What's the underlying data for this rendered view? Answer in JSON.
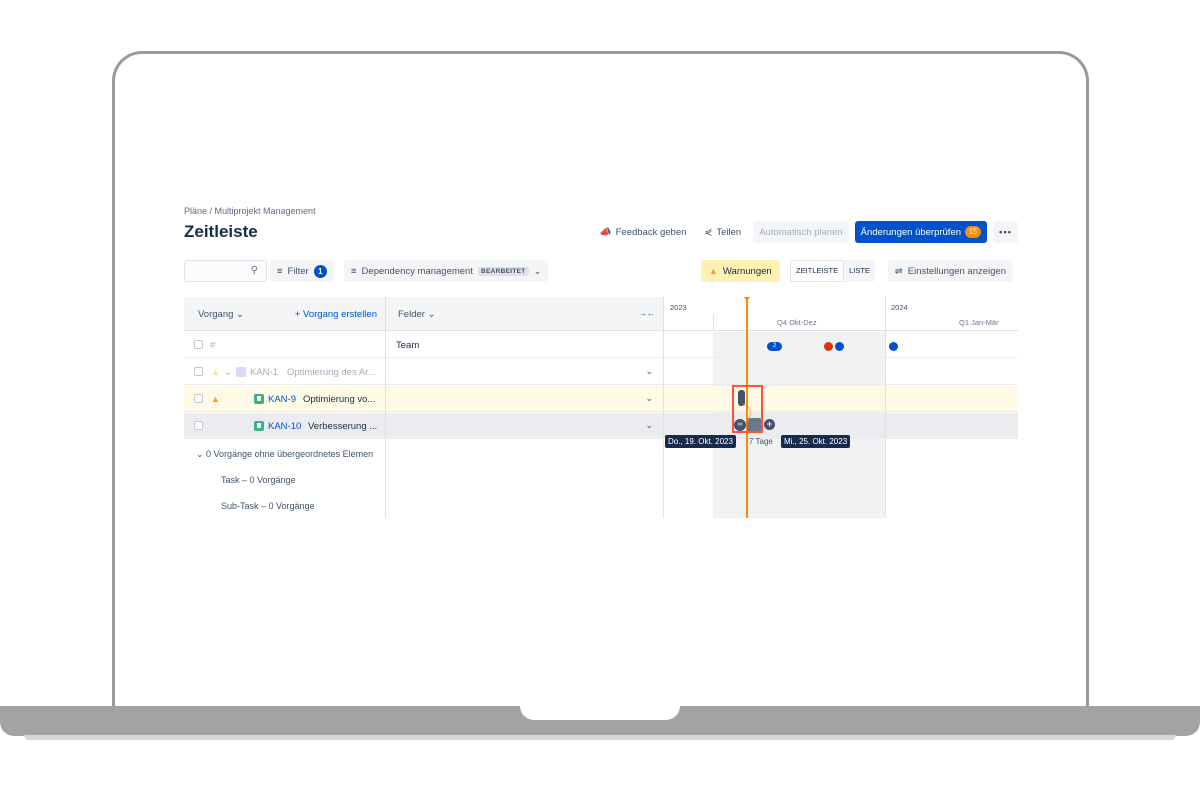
{
  "breadcrumb": "Pläne  /  Multiprojekt Management",
  "title": "Zeitleiste",
  "actions": {
    "feedback": "Feedback geben",
    "share": "Teilen",
    "auto_plan": "Automatisch planen",
    "review": "Änderungen überprüfen",
    "review_count": "15",
    "more": "•••"
  },
  "toolbar": {
    "filter_label": "Filter",
    "filter_count": "1",
    "view_label": "Dependency management",
    "view_badge": "BEARBEITET",
    "warnings": "Warnungen",
    "view_timeline": "ZEITLEISTE",
    "view_list": "LISTE",
    "settings": "Einstellungen anzeigen"
  },
  "columns": {
    "issue": "Vorgang",
    "create": "+ Vorgang erstellen",
    "fields": "Felder"
  },
  "rows": [
    {
      "num": "#",
      "field": "Team"
    },
    {
      "key": "KAN-1",
      "summary": "Optimierung des Ar..."
    },
    {
      "key": "KAN-9",
      "summary": "Optimierung vo..."
    },
    {
      "key": "KAN-10",
      "summary": "Verbesserung ..."
    }
  ],
  "groups": {
    "orphans": "0 Vorgänge ohne übergeordnetes Elemen",
    "task": "Task – 0 Vorgänge",
    "subtask": "Sub-Task – 0 Vorgänge"
  },
  "timeline": {
    "year1": "2023",
    "quarter1": "Q4 Okt-Dez",
    "year2": "2024",
    "quarter2": "Q1 Jan-Mär",
    "cluster_count": "2",
    "start_date": "Do., 19. Okt. 2023",
    "duration": "7 Tage",
    "end_date": "Mi., 25. Okt. 2023"
  },
  "colors": {
    "primary": "#0052cc",
    "warning": "#ff991f",
    "today": "#ff8b00",
    "selection": "#ff5630"
  }
}
